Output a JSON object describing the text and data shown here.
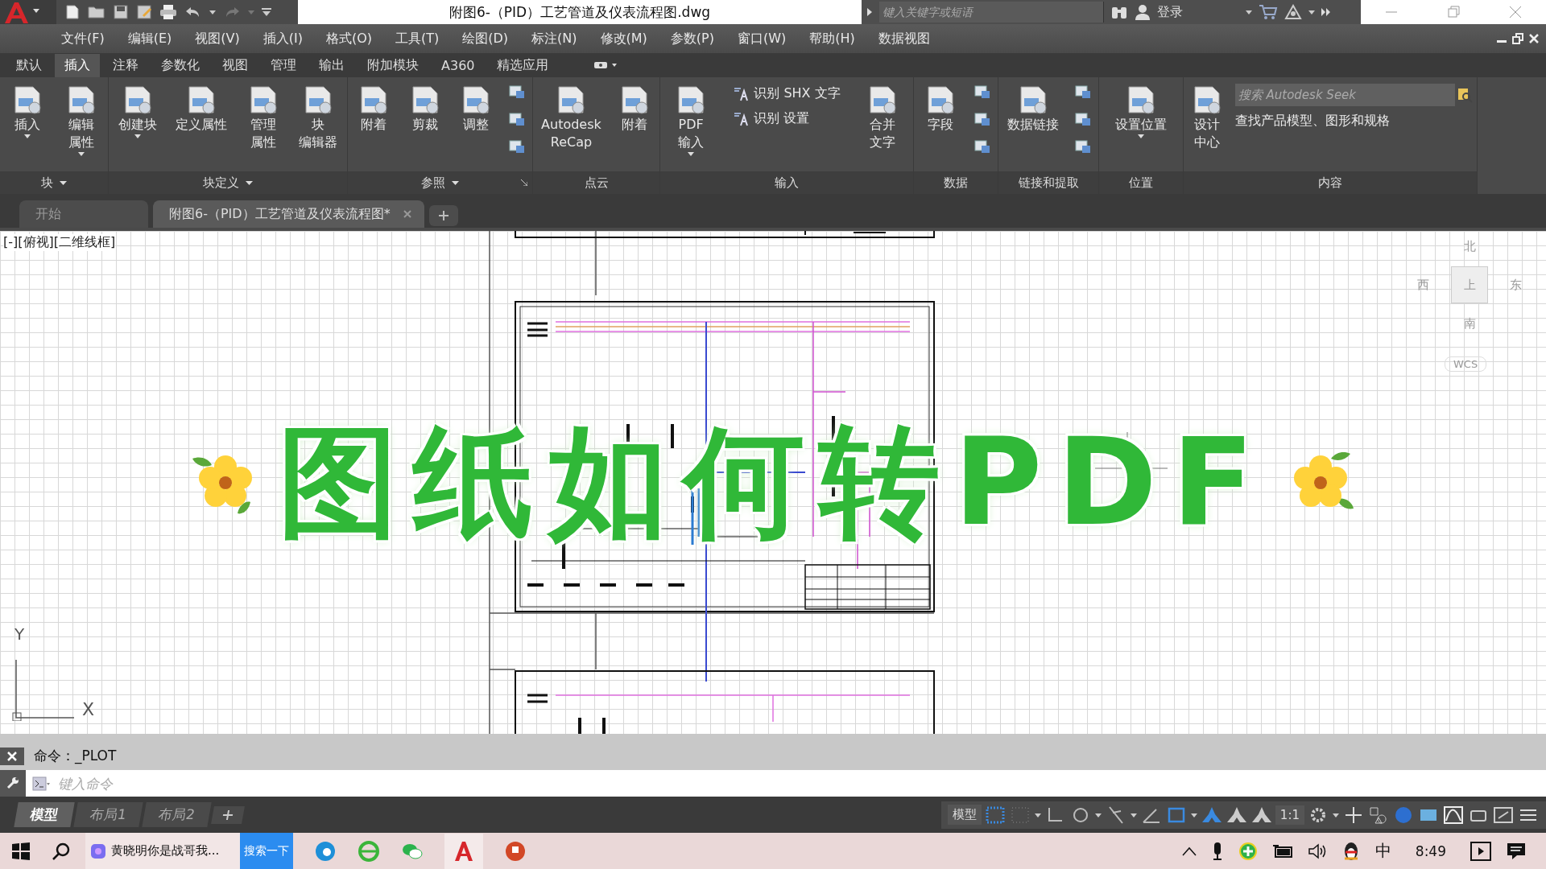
{
  "window": {
    "title": "附图6-（PID）工艺管道及仪表流程图.dwg",
    "search_placeholder": "键入关键字或短语",
    "sign_in": "登录"
  },
  "menu": [
    "文件(F)",
    "编辑(E)",
    "视图(V)",
    "插入(I)",
    "格式(O)",
    "工具(T)",
    "绘图(D)",
    "标注(N)",
    "修改(M)",
    "参数(P)",
    "窗口(W)",
    "帮助(H)",
    "数据视图"
  ],
  "ribbon_tabs": [
    {
      "label": "默认",
      "selected": false
    },
    {
      "label": "插入",
      "selected": true
    },
    {
      "label": "注释",
      "selected": false
    },
    {
      "label": "参数化",
      "selected": false
    },
    {
      "label": "视图",
      "selected": false
    },
    {
      "label": "管理",
      "selected": false
    },
    {
      "label": "输出",
      "selected": false
    },
    {
      "label": "附加模块",
      "selected": false
    },
    {
      "label": "A360",
      "selected": false
    },
    {
      "label": "精选应用",
      "selected": false
    }
  ],
  "ribbon_panels": [
    {
      "title": "块",
      "dropdown": true,
      "launcher": false,
      "items": [
        {
          "kind": "large",
          "lines": [
            "插入"
          ],
          "dropdown": true
        },
        {
          "kind": "large",
          "lines": [
            "编辑",
            "属性"
          ],
          "dropdown": true
        }
      ]
    },
    {
      "title": "块定义",
      "dropdown": true,
      "launcher": false,
      "items": [
        {
          "kind": "large",
          "lines": [
            "创建块"
          ],
          "dropdown": true
        },
        {
          "kind": "large",
          "lines": [
            "定义属性"
          ],
          "dropdown": false
        },
        {
          "kind": "large",
          "lines": [
            "管理",
            "属性"
          ],
          "dropdown": false
        },
        {
          "kind": "large",
          "lines": [
            "块",
            "编辑器"
          ],
          "dropdown": false
        }
      ]
    },
    {
      "title": "参照",
      "dropdown": true,
      "launcher": true,
      "items": [
        {
          "kind": "large",
          "lines": [
            "附着"
          ],
          "dropdown": false
        },
        {
          "kind": "large",
          "lines": [
            "剪裁"
          ],
          "dropdown": false
        },
        {
          "kind": "large",
          "lines": [
            "调整"
          ],
          "dropdown": false
        },
        {
          "kind": "icons"
        }
      ]
    },
    {
      "title": "点云",
      "dropdown": false,
      "launcher": false,
      "items": [
        {
          "kind": "large",
          "lines": [
            "Autodesk",
            "ReCap"
          ],
          "dropdown": false
        },
        {
          "kind": "large",
          "lines": [
            "附着"
          ],
          "dropdown": false
        }
      ]
    },
    {
      "title": "输入",
      "dropdown": false,
      "launcher": false,
      "items": [
        {
          "kind": "large",
          "lines": [
            "PDF",
            "输入"
          ],
          "dropdown": true
        },
        {
          "kind": "small",
          "labels": [
            "识别 SHX 文字",
            "识别 设置"
          ]
        },
        {
          "kind": "large",
          "lines": [
            "合并",
            "文字"
          ],
          "dropdown": false
        }
      ]
    },
    {
      "title": "数据",
      "dropdown": false,
      "launcher": false,
      "items": [
        {
          "kind": "large",
          "lines": [
            "字段"
          ],
          "dropdown": false
        },
        {
          "kind": "icons"
        }
      ]
    },
    {
      "title": "链接和提取",
      "dropdown": false,
      "launcher": false,
      "items": [
        {
          "kind": "large",
          "lines": [
            "数据链接"
          ],
          "dropdown": false
        },
        {
          "kind": "icons"
        }
      ]
    },
    {
      "title": "位置",
      "dropdown": false,
      "launcher": false,
      "items": [
        {
          "kind": "large",
          "lines": [
            "设置位置"
          ],
          "dropdown": true
        }
      ]
    },
    {
      "title": "内容",
      "dropdown": false,
      "launcher": false,
      "items": [
        {
          "kind": "large",
          "lines": [
            "设计",
            "中心"
          ],
          "dropdown": false
        },
        {
          "kind": "seek",
          "placeholder": "搜索 Autodesk Seek",
          "caption": "查找产品模型、图形和规格"
        }
      ]
    }
  ],
  "doc_tabs": [
    {
      "label": "开始",
      "selected": false
    },
    {
      "label": "附图6-（PID）工艺管道及仪表流程图*",
      "selected": true
    }
  ],
  "viewport_label": "[-][俯视][二维线框]",
  "viewcube": {
    "north": "北",
    "top": "上",
    "south": "南",
    "west": "西",
    "east": "东",
    "wcs": "WCS"
  },
  "ucs": {
    "y": "Y",
    "x": "X"
  },
  "overlay_title": "图纸如何转PDF",
  "command": {
    "history": "命令：_PLOT",
    "placeholder": "键入命令"
  },
  "layout_tabs": [
    {
      "label": "模型",
      "selected": true
    },
    {
      "label": "布局1",
      "selected": false
    },
    {
      "label": "布局2",
      "selected": false
    }
  ],
  "status_bar": {
    "space": "模型",
    "scale": "1:1"
  },
  "taskbar": {
    "search_text": "黄晓明你是战哥我...",
    "search_button": "搜索一下",
    "ime": "中",
    "time": "8:49"
  }
}
